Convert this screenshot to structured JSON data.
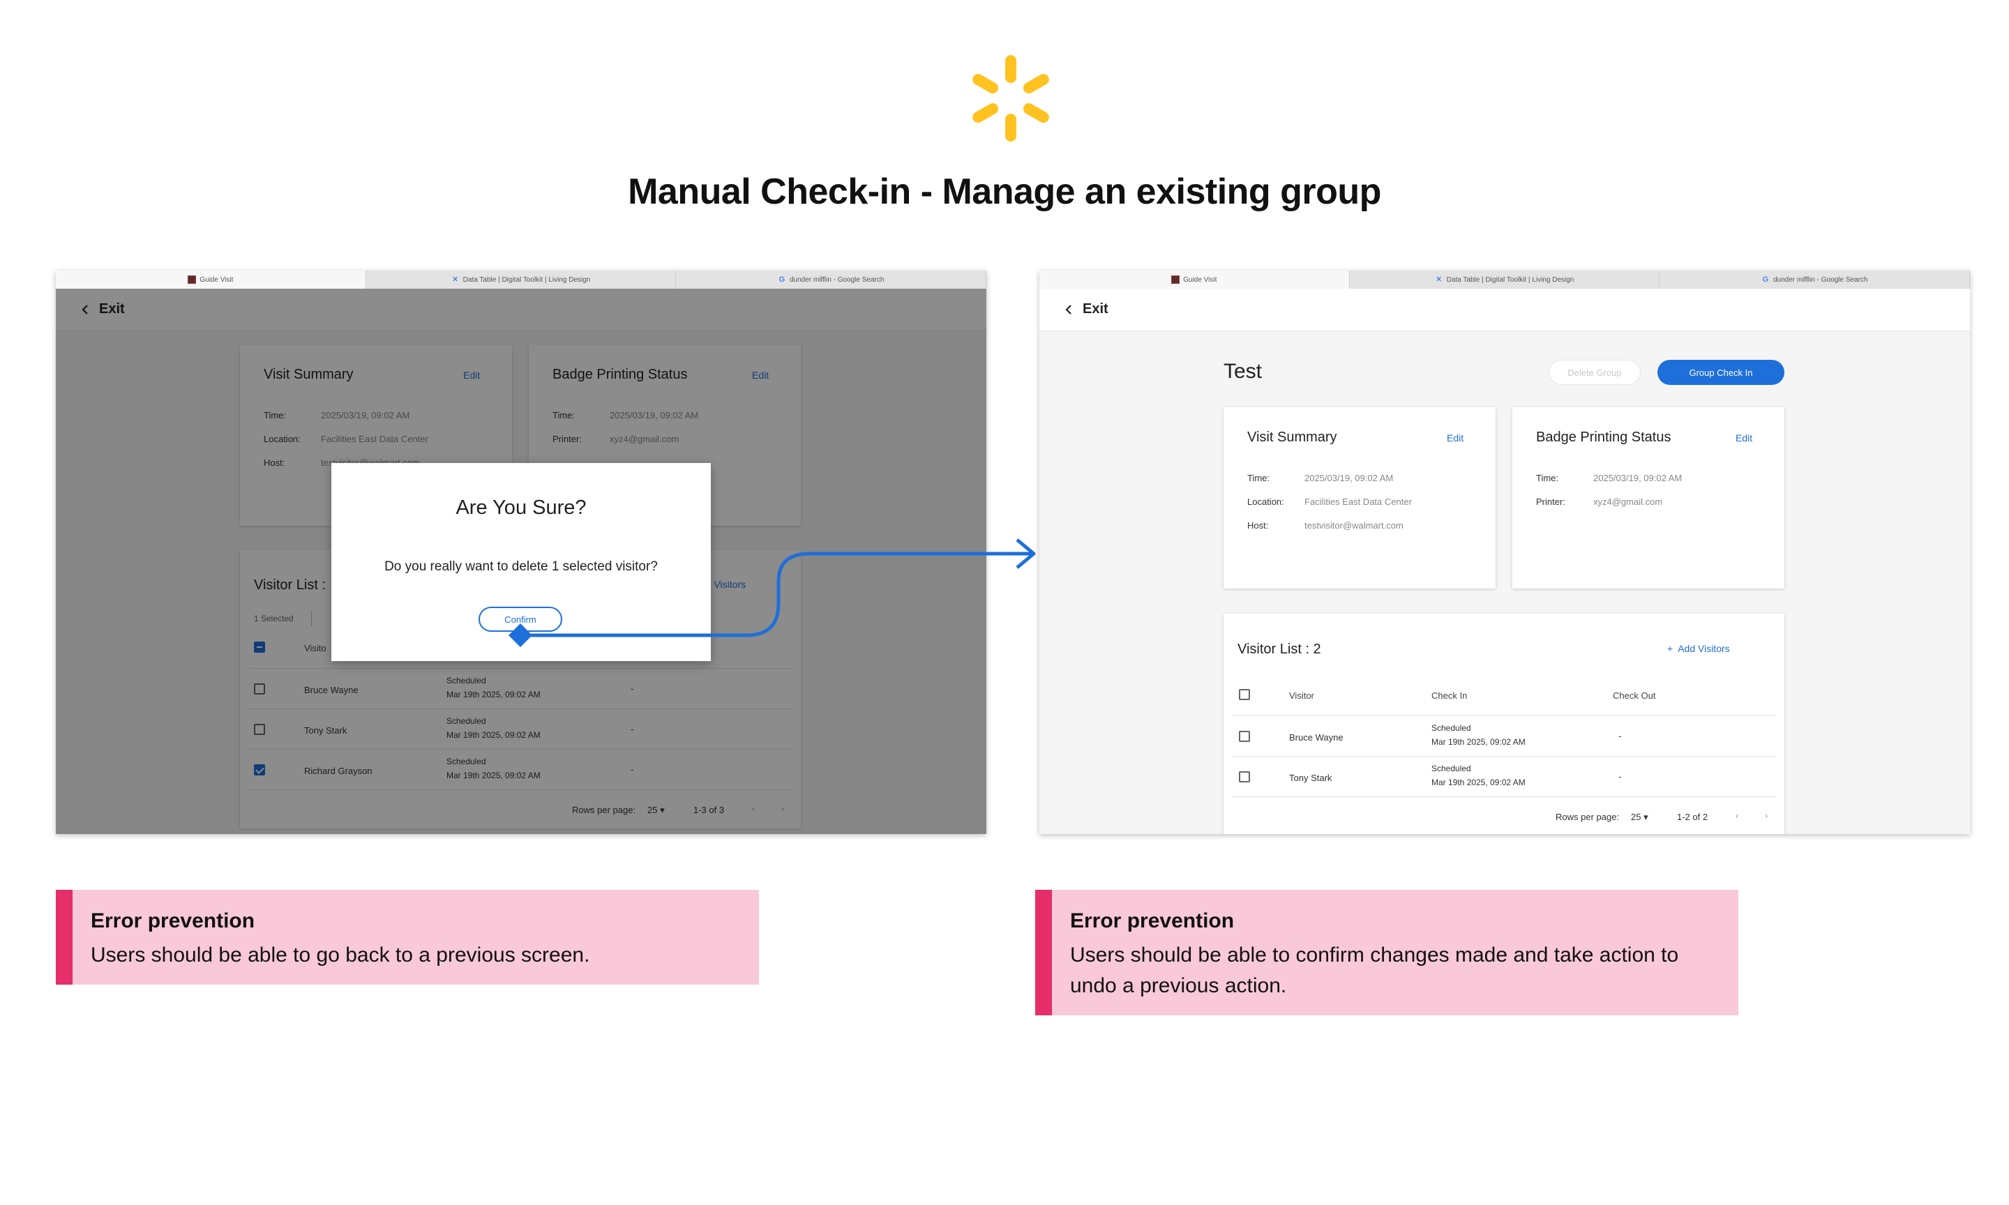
{
  "page_title": "Manual Check-in - Manage an existing group",
  "brand": {
    "logo": "walmart-spark-logo",
    "spark_color": "#ffc220"
  },
  "colors": {
    "accent_blue": "#1e6fd9",
    "note_bg": "#f9c8d9",
    "note_bar": "#e62e6b"
  },
  "browser_tabs": [
    "Guide Visit",
    "Data Table | Digital Toolkit | Living Design",
    "dunder mifflin - Google Search"
  ],
  "left_screen": {
    "exit_label": "Exit",
    "visit_summary": {
      "title": "Visit Summary",
      "edit": "Edit",
      "time_label": "Time:",
      "time_value": "2025/03/19, 09:02 AM",
      "location_label": "Location:",
      "location_value": "Facilities East Data Center",
      "host_label": "Host:",
      "host_value": "testvisitor@walmart.com"
    },
    "badge_status": {
      "title": "Badge Printing Status",
      "edit": "Edit",
      "time_label": "Time:",
      "time_value": "2025/03/19, 09:02 AM",
      "printer_label": "Printer:",
      "printer_value": "xyz4@gmail.com"
    },
    "visitor_list": {
      "title": "Visitor List :",
      "selected": "1 Selected",
      "add_visitors": "dd Visitors",
      "visitor_header": "Visito",
      "rows": [
        {
          "name": "Bruce Wayne",
          "status": "Scheduled",
          "date": "Mar 19th 2025, 09:02 AM",
          "checkout": "-",
          "checked": false
        },
        {
          "name": "Tony Stark",
          "status": "Scheduled",
          "date": "Mar 19th 2025, 09:02 AM",
          "checkout": "-",
          "checked": false
        },
        {
          "name": "Richard Grayson",
          "status": "Scheduled",
          "date": "Mar 19th 2025, 09:02 AM",
          "checkout": "-",
          "checked": true
        }
      ],
      "rows_per_page_label": "Rows per page:",
      "rows_per_page": "25",
      "range": "1-3 of 3"
    },
    "modal": {
      "title": "Are You Sure?",
      "body": "Do you really want to delete 1 selected visitor?",
      "confirm": "Confirm"
    }
  },
  "right_screen": {
    "exit_label": "Exit",
    "group_title": "Test",
    "delete_group": "Delete Group",
    "group_check_in": "Group Check In",
    "visit_summary": {
      "title": "Visit Summary",
      "edit": "Edit",
      "time_label": "Time:",
      "time_value": "2025/03/19, 09:02 AM",
      "location_label": "Location:",
      "location_value": "Facilities East Data Center",
      "host_label": "Host:",
      "host_value": "testvisitor@walmart.com"
    },
    "badge_status": {
      "title": "Badge Printing Status",
      "edit": "Edit",
      "time_label": "Time:",
      "time_value": "2025/03/19, 09:02 AM",
      "printer_label": "Printer:",
      "printer_value": "xyz4@gmail.com"
    },
    "visitor_list": {
      "title": "Visitor List : 2",
      "add_visitors": "Add Visitors",
      "headers": {
        "visitor": "Visitor",
        "check_in": "Check In",
        "check_out": "Check Out"
      },
      "rows": [
        {
          "name": "Bruce Wayne",
          "status": "Scheduled",
          "date": "Mar 19th 2025, 09:02 AM",
          "checkout": "-"
        },
        {
          "name": "Tony Stark",
          "status": "Scheduled",
          "date": "Mar 19th 2025, 09:02 AM",
          "checkout": "-"
        }
      ],
      "rows_per_page_label": "Rows per page:",
      "rows_per_page": "25",
      "range": "1-2 of 2"
    }
  },
  "notes": [
    {
      "title": "Error prevention",
      "text": "Users should be able to go back to a previous screen."
    },
    {
      "title": "Error prevention",
      "text": "Users should be able to confirm changes made and take action to undo a previous action."
    }
  ]
}
